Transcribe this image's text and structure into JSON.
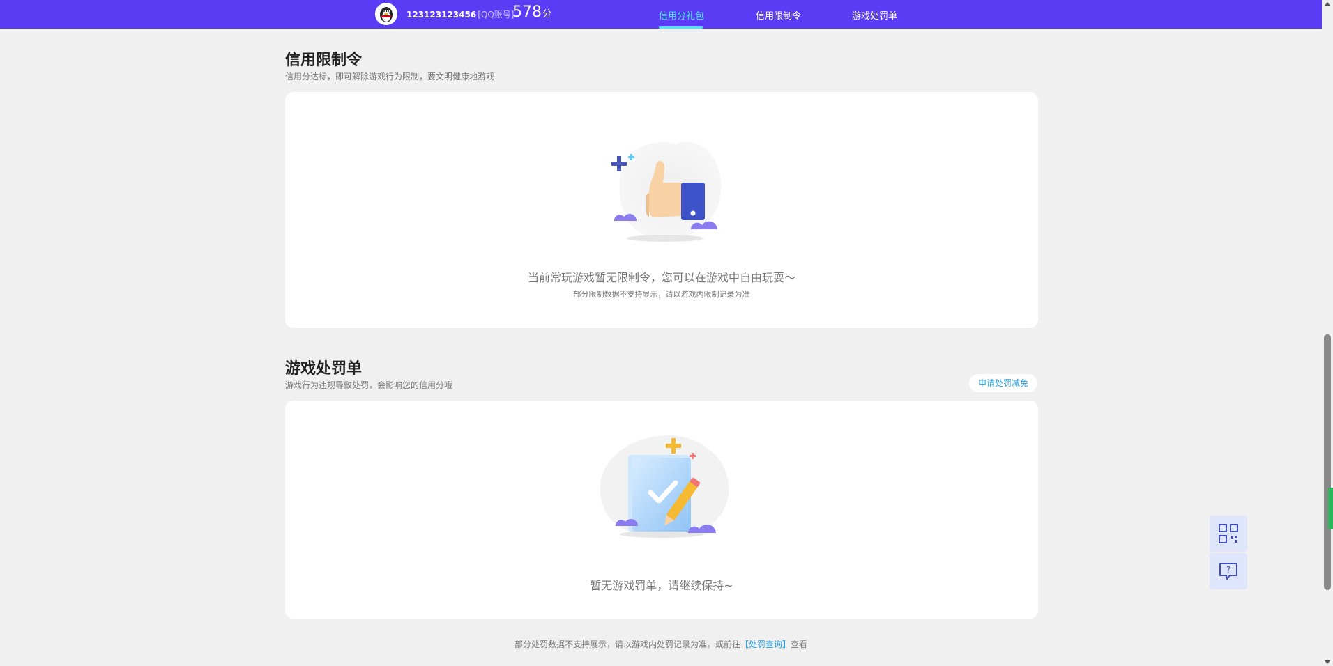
{
  "header": {
    "account_number": "123123123456",
    "account_type": "[QQ账号]",
    "score_value": "578",
    "score_unit": "分",
    "tabs": [
      {
        "label": "信用分礼包",
        "active": true
      },
      {
        "label": "信用限制令",
        "active": false
      },
      {
        "label": "游戏处罚单",
        "active": false
      }
    ]
  },
  "restriction": {
    "title": "信用限制令",
    "subtitle": "信用分达标，即可解除游戏行为限制，要文明健康地游戏",
    "empty_text": "当前常玩游戏暂无限制令，您可以在游戏中自由玩耍～",
    "empty_note": "部分限制数据不支持显示，请以游戏内限制记录为准",
    "illustration_icon": "thumbs-up-icon"
  },
  "penalty": {
    "title": "游戏处罚单",
    "subtitle": "游戏行为违规导致处罚，会影响您的信用分哦",
    "appeal_button": "申请处罚减免",
    "empty_text": "暂无游戏罚单，请继续保持~",
    "illustration_icon": "notebook-check-icon"
  },
  "footer": {
    "note_prefix": "部分处罚数据不支持展示，请以游戏内处罚记录为准，或前往",
    "link_text": "【处罚查询】",
    "note_suffix": "查看"
  },
  "floating": {
    "qr_icon": "qr-code-icon",
    "help_icon": "help-chat-icon"
  },
  "colors": {
    "header_bg": "#5b3cf5",
    "active_tab": "#4fe3ff",
    "link": "#28a0e0",
    "page_bg": "#f0f0f0"
  }
}
